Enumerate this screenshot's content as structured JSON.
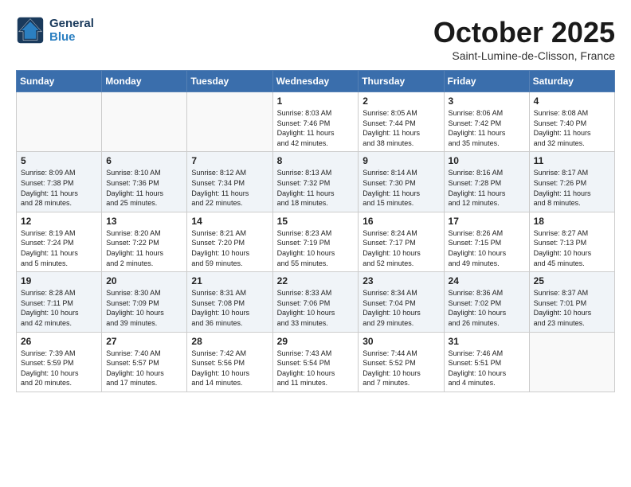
{
  "header": {
    "logo_line1": "General",
    "logo_line2": "Blue",
    "month": "October 2025",
    "location": "Saint-Lumine-de-Clisson, France"
  },
  "weekdays": [
    "Sunday",
    "Monday",
    "Tuesday",
    "Wednesday",
    "Thursday",
    "Friday",
    "Saturday"
  ],
  "weeks": [
    [
      {
        "day": "",
        "info": ""
      },
      {
        "day": "",
        "info": ""
      },
      {
        "day": "",
        "info": ""
      },
      {
        "day": "1",
        "info": "Sunrise: 8:03 AM\nSunset: 7:46 PM\nDaylight: 11 hours\nand 42 minutes."
      },
      {
        "day": "2",
        "info": "Sunrise: 8:05 AM\nSunset: 7:44 PM\nDaylight: 11 hours\nand 38 minutes."
      },
      {
        "day": "3",
        "info": "Sunrise: 8:06 AM\nSunset: 7:42 PM\nDaylight: 11 hours\nand 35 minutes."
      },
      {
        "day": "4",
        "info": "Sunrise: 8:08 AM\nSunset: 7:40 PM\nDaylight: 11 hours\nand 32 minutes."
      }
    ],
    [
      {
        "day": "5",
        "info": "Sunrise: 8:09 AM\nSunset: 7:38 PM\nDaylight: 11 hours\nand 28 minutes."
      },
      {
        "day": "6",
        "info": "Sunrise: 8:10 AM\nSunset: 7:36 PM\nDaylight: 11 hours\nand 25 minutes."
      },
      {
        "day": "7",
        "info": "Sunrise: 8:12 AM\nSunset: 7:34 PM\nDaylight: 11 hours\nand 22 minutes."
      },
      {
        "day": "8",
        "info": "Sunrise: 8:13 AM\nSunset: 7:32 PM\nDaylight: 11 hours\nand 18 minutes."
      },
      {
        "day": "9",
        "info": "Sunrise: 8:14 AM\nSunset: 7:30 PM\nDaylight: 11 hours\nand 15 minutes."
      },
      {
        "day": "10",
        "info": "Sunrise: 8:16 AM\nSunset: 7:28 PM\nDaylight: 11 hours\nand 12 minutes."
      },
      {
        "day": "11",
        "info": "Sunrise: 8:17 AM\nSunset: 7:26 PM\nDaylight: 11 hours\nand 8 minutes."
      }
    ],
    [
      {
        "day": "12",
        "info": "Sunrise: 8:19 AM\nSunset: 7:24 PM\nDaylight: 11 hours\nand 5 minutes."
      },
      {
        "day": "13",
        "info": "Sunrise: 8:20 AM\nSunset: 7:22 PM\nDaylight: 11 hours\nand 2 minutes."
      },
      {
        "day": "14",
        "info": "Sunrise: 8:21 AM\nSunset: 7:20 PM\nDaylight: 10 hours\nand 59 minutes."
      },
      {
        "day": "15",
        "info": "Sunrise: 8:23 AM\nSunset: 7:19 PM\nDaylight: 10 hours\nand 55 minutes."
      },
      {
        "day": "16",
        "info": "Sunrise: 8:24 AM\nSunset: 7:17 PM\nDaylight: 10 hours\nand 52 minutes."
      },
      {
        "day": "17",
        "info": "Sunrise: 8:26 AM\nSunset: 7:15 PM\nDaylight: 10 hours\nand 49 minutes."
      },
      {
        "day": "18",
        "info": "Sunrise: 8:27 AM\nSunset: 7:13 PM\nDaylight: 10 hours\nand 45 minutes."
      }
    ],
    [
      {
        "day": "19",
        "info": "Sunrise: 8:28 AM\nSunset: 7:11 PM\nDaylight: 10 hours\nand 42 minutes."
      },
      {
        "day": "20",
        "info": "Sunrise: 8:30 AM\nSunset: 7:09 PM\nDaylight: 10 hours\nand 39 minutes."
      },
      {
        "day": "21",
        "info": "Sunrise: 8:31 AM\nSunset: 7:08 PM\nDaylight: 10 hours\nand 36 minutes."
      },
      {
        "day": "22",
        "info": "Sunrise: 8:33 AM\nSunset: 7:06 PM\nDaylight: 10 hours\nand 33 minutes."
      },
      {
        "day": "23",
        "info": "Sunrise: 8:34 AM\nSunset: 7:04 PM\nDaylight: 10 hours\nand 29 minutes."
      },
      {
        "day": "24",
        "info": "Sunrise: 8:36 AM\nSunset: 7:02 PM\nDaylight: 10 hours\nand 26 minutes."
      },
      {
        "day": "25",
        "info": "Sunrise: 8:37 AM\nSunset: 7:01 PM\nDaylight: 10 hours\nand 23 minutes."
      }
    ],
    [
      {
        "day": "26",
        "info": "Sunrise: 7:39 AM\nSunset: 5:59 PM\nDaylight: 10 hours\nand 20 minutes."
      },
      {
        "day": "27",
        "info": "Sunrise: 7:40 AM\nSunset: 5:57 PM\nDaylight: 10 hours\nand 17 minutes."
      },
      {
        "day": "28",
        "info": "Sunrise: 7:42 AM\nSunset: 5:56 PM\nDaylight: 10 hours\nand 14 minutes."
      },
      {
        "day": "29",
        "info": "Sunrise: 7:43 AM\nSunset: 5:54 PM\nDaylight: 10 hours\nand 11 minutes."
      },
      {
        "day": "30",
        "info": "Sunrise: 7:44 AM\nSunset: 5:52 PM\nDaylight: 10 hours\nand 7 minutes."
      },
      {
        "day": "31",
        "info": "Sunrise: 7:46 AM\nSunset: 5:51 PM\nDaylight: 10 hours\nand 4 minutes."
      },
      {
        "day": "",
        "info": ""
      }
    ]
  ]
}
